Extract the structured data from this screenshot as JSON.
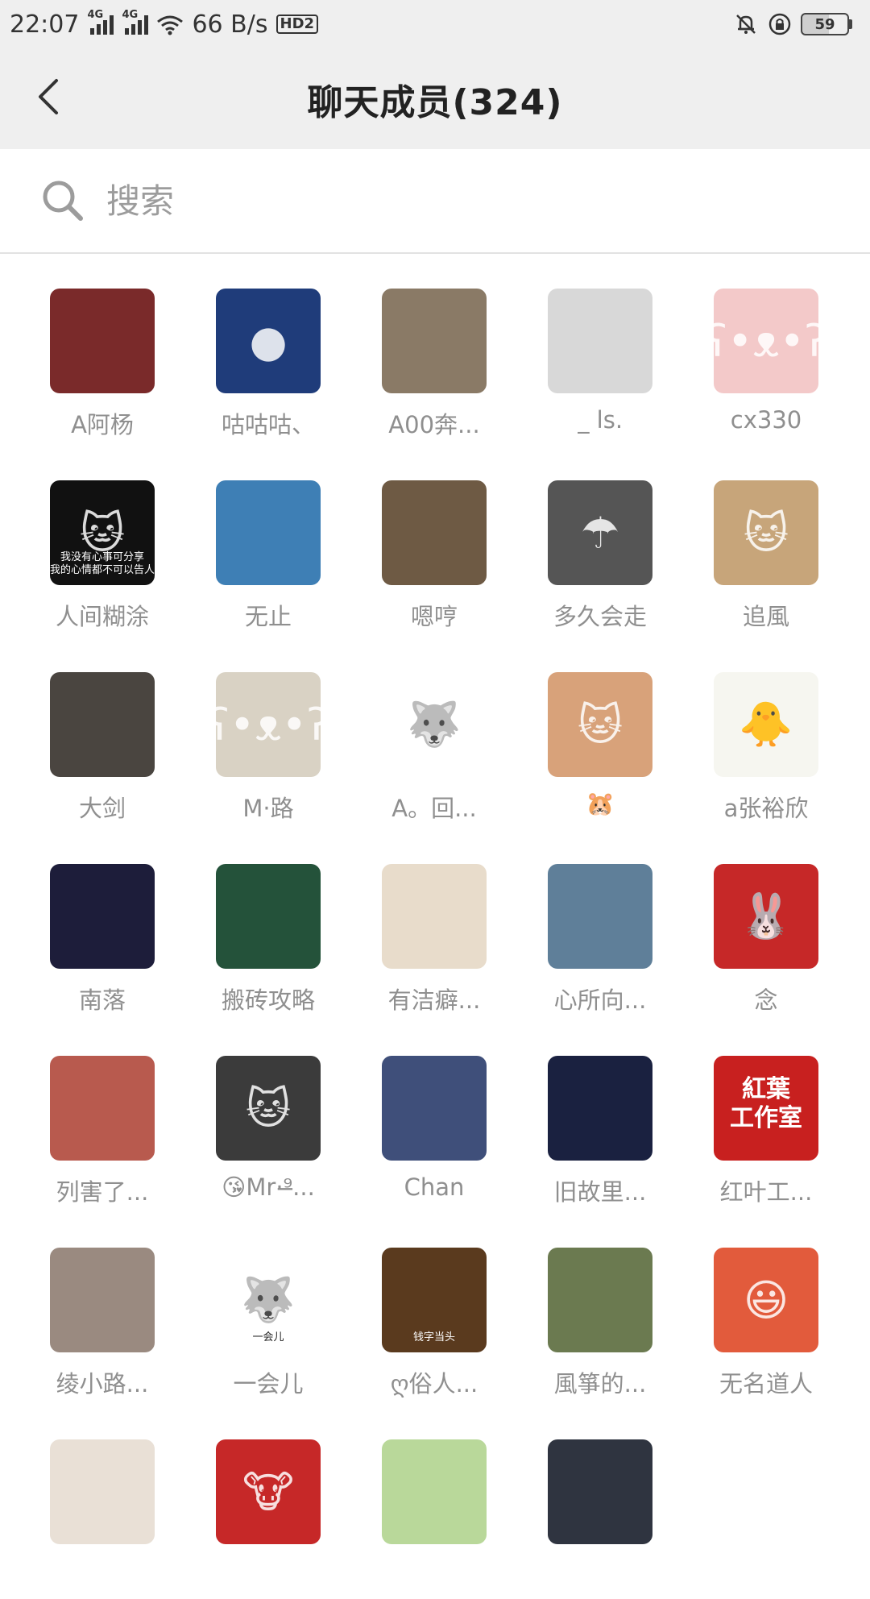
{
  "status_bar": {
    "time": "22:07",
    "network_tag_1": "4G",
    "network_tag_2": "4G",
    "speed": "66 B/s",
    "hd_label": "HD2",
    "battery": "59"
  },
  "header": {
    "title": "聊天成员(324)",
    "back_icon": "chevron-left-icon"
  },
  "search": {
    "placeholder": "搜索",
    "icon": "search-icon"
  },
  "members": [
    {
      "name": "A阿杨",
      "bg": "#7a2a2a",
      "glyph": ""
    },
    {
      "name": "咕咕咕、",
      "bg": "#1f3c7a",
      "glyph": "●"
    },
    {
      "name": "A00奔...",
      "bg": "#8a7a66",
      "glyph": ""
    },
    {
      "name": "_          ls.",
      "bg": "#d8d8d8",
      "glyph": ""
    },
    {
      "name": "cx330",
      "bg": "#f3c9c9",
      "glyph": "ʕ•ᴥ•ʔ"
    },
    {
      "name": "人间糊涂",
      "bg": "#111111",
      "glyph": "🐱",
      "text": "我没有心事可分享\n我的心情都不可以告人"
    },
    {
      "name": "无止",
      "bg": "#3e7fb5",
      "glyph": ""
    },
    {
      "name": "嗯哼",
      "bg": "#6e5a44",
      "glyph": ""
    },
    {
      "name": "多久会走",
      "bg": "#555555",
      "glyph": "☂"
    },
    {
      "name": "追風",
      "bg": "#c7a57a",
      "glyph": "🐱"
    },
    {
      "name": "大剑",
      "bg": "#4a4540",
      "glyph": ""
    },
    {
      "name": "M·路",
      "bg": "#d9d2c4",
      "glyph": "ʕ•ᴥ•ʔ"
    },
    {
      "name": "A。回...",
      "bg": "#ffffff",
      "glyph": "🐺"
    },
    {
      "name": "🐹",
      "bg": "#d8a27a",
      "glyph": "🐱"
    },
    {
      "name": "a张裕欣",
      "bg": "#f6f6f0",
      "glyph": "🐥"
    },
    {
      "name": "南落",
      "bg": "#1d1d3a",
      "glyph": ""
    },
    {
      "name": "搬砖攻略",
      "bg": "#24523a",
      "glyph": ""
    },
    {
      "name": "有洁癖...",
      "bg": "#e8dccb",
      "glyph": ""
    },
    {
      "name": "心所向...",
      "bg": "#5f7f99",
      "glyph": ""
    },
    {
      "name": "念",
      "bg": "#c62828",
      "glyph": "🐰"
    },
    {
      "name": "列害了...",
      "bg": "#b85a4e",
      "glyph": ""
    },
    {
      "name": "😘Mr·⁹̶...",
      "bg": "#3b3b3b",
      "glyph": "🐱"
    },
    {
      "name": "Chan",
      "bg": "#3f4f7a",
      "glyph": ""
    },
    {
      "name": "旧故里...",
      "bg": "#1a2140",
      "glyph": ""
    },
    {
      "name": "红叶工...",
      "bg": "#c8201f",
      "glyph": "",
      "text": "紅葉\n工作室"
    },
    {
      "name": "绫小路...",
      "bg": "#9a8a80",
      "glyph": ""
    },
    {
      "name": "一会儿",
      "bg": "#ffffff",
      "glyph": "🐺",
      "text": "一会儿"
    },
    {
      "name": "ღ俗人...",
      "bg": "#5a3a1e",
      "glyph": "",
      "text": "钱字当头"
    },
    {
      "name": "風箏的...",
      "bg": "#6b7a50",
      "glyph": ""
    },
    {
      "name": "无名道人",
      "bg": "#e25b3c",
      "glyph": "😃"
    },
    {
      "name": "",
      "bg": "#e9e0d6",
      "glyph": ""
    },
    {
      "name": "",
      "bg": "#c62828",
      "glyph": "🐮"
    },
    {
      "name": "",
      "bg": "#b9d89a",
      "glyph": ""
    },
    {
      "name": "",
      "bg": "#2f3440",
      "glyph": ""
    },
    {
      "name": "",
      "bg": "#ffffff",
      "glyph": ""
    }
  ]
}
